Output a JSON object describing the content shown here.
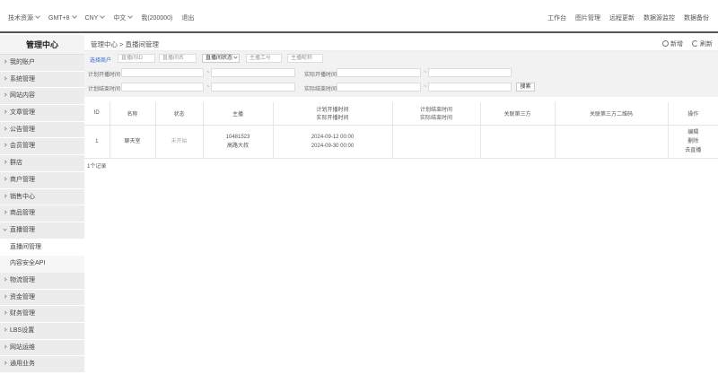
{
  "topbar": {
    "left": [
      "技术资源",
      "GMT+8",
      "CNY",
      "中文",
      "我(200000)",
      "退出"
    ],
    "right": [
      "工作台",
      "图片管理",
      "远程更新",
      "数据源监控",
      "数据备份"
    ]
  },
  "sidebar": {
    "title": "管理中心",
    "items_top": [
      "我的账户",
      "系统管理",
      "网站内容",
      "文章管理",
      "公告管理",
      "会员管理",
      "群店",
      "商户管理",
      "销售中心",
      "商品管理",
      "直播管理"
    ],
    "subitems": [
      "直播间管理",
      "内容安全API"
    ],
    "items_bottom": [
      "物流管理",
      "资金管理",
      "财务管理",
      "LBS设置",
      "网站运维",
      "通用业务"
    ]
  },
  "breadcrumb": "管理中心 > 直播间管理",
  "actions": {
    "add": "新增",
    "refresh": "刷新"
  },
  "filters": {
    "select_merchant": "选择商户",
    "room_id": "直播间ID",
    "room_name": "直播间名",
    "room_status": "直播间状态",
    "host_id": "主播工号",
    "host_nick": "主播昵称",
    "plan_start": "计划开播时间",
    "actual_start": "实际开播时间",
    "plan_end": "计划结束时间",
    "actual_end": "实际结束时间",
    "tilde": "~",
    "search": "搜索"
  },
  "table": {
    "headers": {
      "id": "ID",
      "name": "名称",
      "status": "状态",
      "host": "主播",
      "plan_start_1": "计划开播时间",
      "plan_start_2": "实际开播时间",
      "plan_end_1": "计划结束时间",
      "plan_end_2": "实际结束时间",
      "third": "关联第三方",
      "qr": "关联第三方二维码",
      "op": "操作"
    },
    "row": {
      "id": "1",
      "name": "聊天室",
      "status": "未开始",
      "host_id": "10481523",
      "host_name": "高路大叔",
      "plan_start": "2024-09-12 00:00",
      "plan_end": "2024-09-30 00:00",
      "op_edit": "编辑",
      "op_delete": "删除",
      "op_live": "去直播"
    }
  },
  "records": "1个记录"
}
